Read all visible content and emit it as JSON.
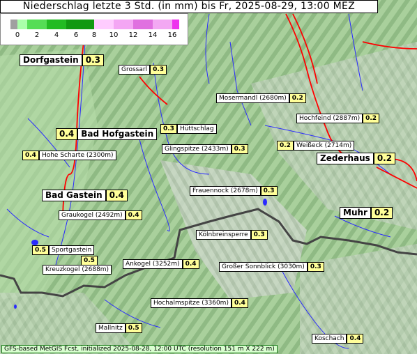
{
  "title": "Niederschlag letzte 3 Std. (in mm) bis Fr, 2025-08-29, 13:00 MEZ",
  "legend": {
    "ticks": [
      "0",
      "2",
      "4",
      "6",
      "8",
      "10",
      "12",
      "14",
      "16"
    ],
    "colors": [
      "#a0a0a0",
      "#aaffaa",
      "#55dd55",
      "#22bb22",
      "#119911",
      "#ffccff",
      "#f4a6f4",
      "#e070e0",
      "#ee33ee"
    ]
  },
  "cities": [
    {
      "name": "Dorfgastein",
      "value": "0.3"
    },
    {
      "name": "Bad Hofgastein",
      "value": "0.4"
    },
    {
      "name": "Bad Gastein",
      "value": "0.4"
    },
    {
      "name": "Zederhaus",
      "value": "0.2"
    },
    {
      "name": "Muhr",
      "value": "0.2"
    }
  ],
  "places": [
    {
      "name": "Grossarl",
      "value": "0.3"
    },
    {
      "name": "Mosermandl (2680m)",
      "value": "0.2"
    },
    {
      "name": "Hochfeind (2887m)",
      "value": "0.2"
    },
    {
      "name": "Hüttschlag",
      "value": "0.3"
    },
    {
      "name": "Glingspitze (2433m)",
      "value": "0.3"
    },
    {
      "name": "Weißeck (2714m)",
      "value": "0.2"
    },
    {
      "name": "Hohe Scharte (2300m)",
      "value": "0.4"
    },
    {
      "name": "Frauennock (2678m)",
      "value": "0.3"
    },
    {
      "name": "Graukogel (2492m)",
      "value": "0.4"
    },
    {
      "name": "Kölnbreinsperre",
      "value": "0.3"
    },
    {
      "name": "Sportgastein",
      "value": "0.5"
    },
    {
      "name": "Kreuzkogel (2688m)",
      "value": "0.5"
    },
    {
      "name": "Ankogel (3252m)",
      "value": "0.4"
    },
    {
      "name": "Großer Sonnblick (3030m)",
      "value": "0.3"
    },
    {
      "name": "Hochalmspitze (3360m)",
      "value": "0.4"
    },
    {
      "name": "Mallnitz",
      "value": "0.5"
    },
    {
      "name": "Koschach",
      "value": "0.4"
    }
  ],
  "footer": "GFS-based MetGIS Fcst, initialized 2025-08-28, 12:00 UTC  (resolution 151 m X 222 m)"
}
